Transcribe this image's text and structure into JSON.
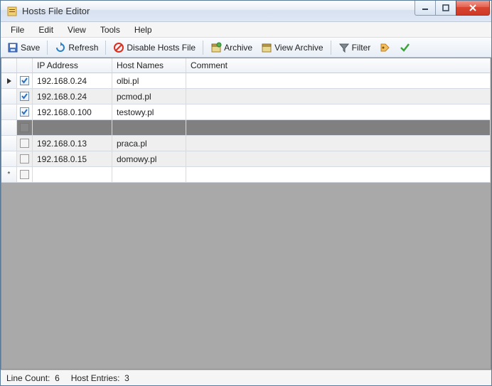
{
  "title": "Hosts File Editor",
  "menu": {
    "file": "File",
    "edit": "Edit",
    "view": "View",
    "tools": "Tools",
    "help": "Help"
  },
  "toolbar": {
    "save": "Save",
    "refresh": "Refresh",
    "disable": "Disable Hosts File",
    "archive": "Archive",
    "view_archive": "View Archive",
    "filter": "Filter"
  },
  "columns": {
    "ip": "IP Address",
    "host": "Host Names",
    "comment": "Comment"
  },
  "rows": [
    {
      "marker": "current",
      "checked": true,
      "ip": "192.168.0.24",
      "host": "olbi.pl",
      "comment": "",
      "alt": false,
      "separator": false
    },
    {
      "marker": "",
      "checked": true,
      "ip": "192.168.0.24",
      "host": "pcmod.pl",
      "comment": "",
      "alt": true,
      "separator": false
    },
    {
      "marker": "",
      "checked": true,
      "ip": "192.168.0.100",
      "host": "testowy.pl",
      "comment": "",
      "alt": false,
      "separator": false
    },
    {
      "marker": "",
      "checked": null,
      "ip": "",
      "host": "",
      "comment": "",
      "alt": false,
      "separator": true
    },
    {
      "marker": "",
      "checked": false,
      "ip": "192.168.0.13",
      "host": "praca.pl",
      "comment": "",
      "alt": true,
      "separator": false
    },
    {
      "marker": "",
      "checked": false,
      "ip": "192.168.0.15",
      "host": "domowy.pl",
      "comment": "",
      "alt": true,
      "separator": false
    },
    {
      "marker": "new",
      "checked": false,
      "ip": "",
      "host": "",
      "comment": "",
      "alt": false,
      "separator": false
    }
  ],
  "status": {
    "line_count_label": "Line Count:",
    "line_count": "6",
    "host_entries_label": "Host Entries:",
    "host_entries": "3"
  }
}
